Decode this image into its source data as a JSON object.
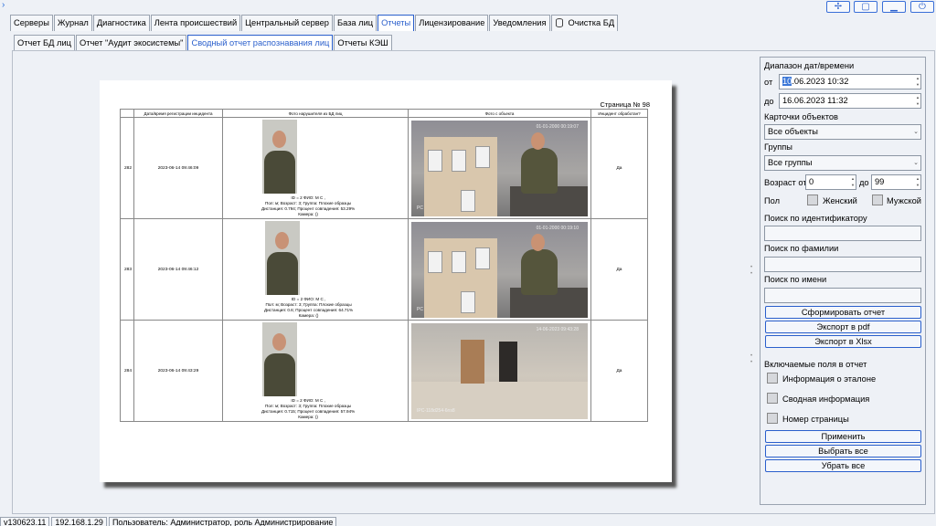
{
  "window": {
    "buttons": [
      {
        "icon": "move-icon",
        "glyph": "✢"
      },
      {
        "icon": "restore-icon",
        "glyph": "▢"
      },
      {
        "icon": "minimize-icon",
        "glyph": "▁"
      },
      {
        "icon": "power-icon",
        "glyph": "⏻"
      }
    ]
  },
  "tabs": {
    "main": [
      "Серверы",
      "Журнал",
      "Диагностика",
      "Лента происшествий",
      "Центральный сервер",
      "База лиц",
      "Отчеты",
      "Лицензирование",
      "Уведомления",
      "Очистка БД"
    ],
    "main_active": "Отчеты",
    "sub": [
      "Отчет БД лиц",
      "Отчет \"Аудит экосистемы\"",
      "Сводный отчет распознавания лиц",
      "Отчеты КЭШ"
    ],
    "sub_active": "Сводный отчет распознавания лиц"
  },
  "report": {
    "page_label": "Страница № 98",
    "columns": [
      "",
      "Дата/время регистрации инцидента",
      "Фото нарушителя из БД лиц",
      "Фото с объекта",
      "Инцидент обработан?"
    ],
    "rows": [
      {
        "id": "282",
        "datetime": "2023-06-14 09:46:09",
        "info": [
          "ID = 2 ФИО: М С ,",
          "Пол: м; Возраст: 3; Группа: Плохие образцы",
          "Дистанция: 0.794; Процент совпадения: 53.29%",
          "Камера: ()"
        ],
        "scene_time": "01-01-2000 00:19:07",
        "cam_label": "PC",
        "processed": "Да"
      },
      {
        "id": "283",
        "datetime": "2023-06-14 09:46:12",
        "info": [
          "ID = 2 ФИО: М С ,",
          "Пол: м; Возраст: 3; Группа: Плохие образцы",
          "Дистанция: 0.6; Процент совпадения: 64.71%",
          "Камера: ()"
        ],
        "scene_time": "01-01-2000 00:19:10",
        "cam_label": "PC",
        "processed": "Да"
      },
      {
        "id": "284",
        "datetime": "2023-06-14 09:43:29",
        "info": [
          "ID = 2 ФИО: М С ,",
          "Пол: м; Возраст: 3; Группа: Плохие образцы",
          "Дистанция: 0.715; Процент совпадения: 57.94%",
          "Камера: ()"
        ],
        "scene_time": "14-06-2023 09:43:28",
        "cam_label": "IPC-118d254-6ns8",
        "processed": "Да"
      }
    ]
  },
  "panel": {
    "range_label": "Диапазон дат/времени",
    "from_label": "от",
    "from_selected": "10",
    "from_rest": ".06.2023 10:32",
    "to_label": "до",
    "to_value": "16.06.2023 11:32",
    "cards_label": "Карточки объектов",
    "cards_value": "Все объекты",
    "groups_label": "Группы",
    "groups_value": "Все группы",
    "age_label": "Возраст от",
    "age_from": "0",
    "age_to_label": "до",
    "age_to": "99",
    "sex_label": "Пол",
    "female": "Женский",
    "male": "Мужской",
    "search_id_label": "Поиск по идентификатору",
    "search_surname_label": "Поиск по фамилии",
    "search_name_label": "Поиск по имени",
    "btn_generate": "Сформировать отчет",
    "btn_pdf": "Экспорт в pdf",
    "btn_xlsx": "Экспорт в Xlsx",
    "fields_label": "Включаемые поля в отчет",
    "field_ref": "Информация о эталоне",
    "field_summary": "Сводная информация",
    "field_page": "Номер страницы",
    "btn_apply": "Применить",
    "btn_select_all": "Выбрать все",
    "btn_clear_all": "Убрать все"
  },
  "status": {
    "version": "v130623.11",
    "ip": "192.168.1.29",
    "user": "Пользователь: Администратор, роль Администрирование"
  }
}
